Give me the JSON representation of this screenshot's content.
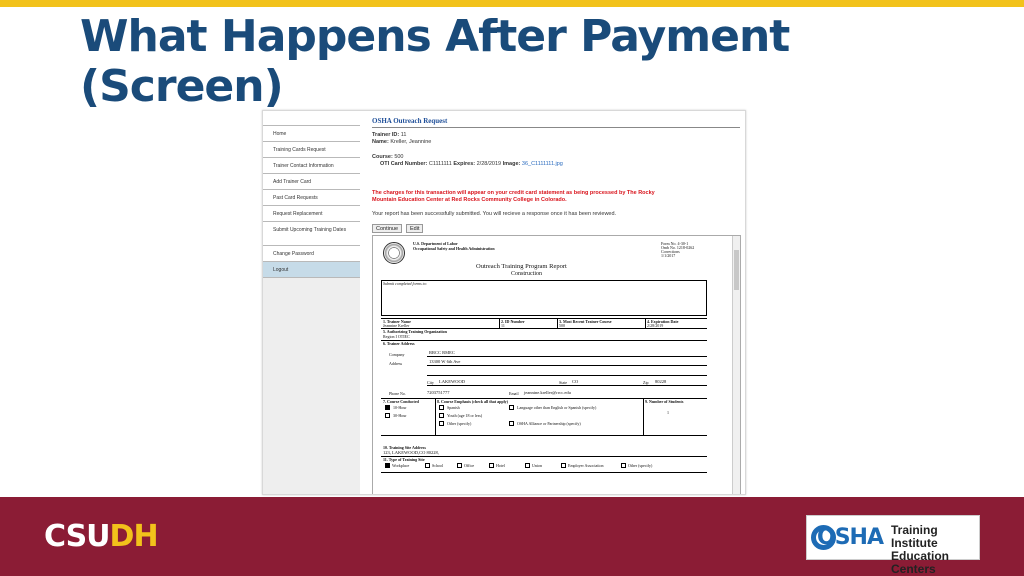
{
  "slide": {
    "title_line1": "What Happens After Payment",
    "title_line2": "(Screen)",
    "footer_logo": {
      "csu": "CSU",
      "dh": "DH"
    },
    "osha_logo": {
      "word": "OSHA",
      "line1": "Training Institute",
      "line2": "Education Centers"
    },
    "colors": {
      "title": "#1a4b7a",
      "footer": "#8b1c35",
      "accent": "#f2c21b"
    }
  },
  "sidebar": {
    "items": [
      {
        "label": "Home"
      },
      {
        "label": "Training Cards Request"
      },
      {
        "label": "Trainer Contact Information"
      },
      {
        "label": "Add Trainer Card"
      },
      {
        "label": "Past Card Requests"
      },
      {
        "label": "Request Replacement"
      },
      {
        "label": "Submit Upcoming Training Dates"
      },
      {
        "label": "Change Password"
      },
      {
        "label": "Logout"
      }
    ]
  },
  "request": {
    "heading": "OSHA Outreach Request",
    "trainer_id_label": "Trainer ID:",
    "trainer_id": "11",
    "name_label": "Name:",
    "name": "Kreller, Jeannine",
    "course_label": "Course:",
    "course": "500",
    "oti_label": "OTI Card Number:",
    "oti": "C1111111",
    "expires_label": "Expires:",
    "expires": "2/28/2019",
    "image_label": "Image:",
    "image": "36_C1111111.jpg",
    "charge_notice_1": "The charges for this transaction will appear on your credit card statement as being processed by The Rocky",
    "charge_notice_2": "Mountain Education Center at Red Rocks Community College in Colorado.",
    "success": "Your report has been successfully submitted. You will recieve a response once it has been reviewed.",
    "continue_label": "Continue",
    "edit_label": "Edit"
  },
  "form": {
    "dept_1": "U.S. Department of Labor",
    "dept_2": "Occupational Safety and Health Administration",
    "form_no_1": "Form No. 4-30-1",
    "form_no_2": "Omb No. 1218-0262",
    "form_no_3": "Corrections",
    "form_no_4": "1/1/2017",
    "title_1": "Outreach Training Program Report",
    "title_2": "Construction",
    "submit_label": "Submit completed forms to:",
    "f1_label": "1.   Trainer Name",
    "f1_value": "Jeannine   Kreller",
    "f2_label": "2.   ID Number",
    "f2_value": "11",
    "f3_label": "3.   Most Recent Trainer Course",
    "f3_value": "500",
    "f4_label": "4.   Expiration Date",
    "f4_value": "2/28/2019",
    "f5_label": "5.   Authorizing Training Organization",
    "f5_value": "Region I OTIEC",
    "f6_label": "6.   Trainer Address",
    "company_label": "Company",
    "company": "RRCC RMEC",
    "address_label": "Address",
    "address": "13300 W 6th Ave",
    "city_label": "City",
    "city": "LAKEWOOD",
    "state_label": "State",
    "state": "CO",
    "zip_label": "Zip",
    "zip": "80228",
    "phone_label": "Phone No.",
    "phone": "7203751777",
    "email_label": "Email",
    "email": "jeannine.kreller@rrcc.edu",
    "f7_label": "7.   Course Conducted",
    "f7_opt1": "10-Hour",
    "f7_opt2": "30-Hour",
    "f8_label": "8.   Course Emphasis (check all that apply)",
    "f8_opt1": "Spanish",
    "f8_opt2": "Language other than English or Spanish (specify)",
    "f8_opt3": "Youth (age 18 or less)",
    "f8_opt4": "Other (specify)",
    "f8_opt5": "OSHA Alliance or Partnership (specify)",
    "f9_label": "9.   Number of Students",
    "f9_value": "1",
    "f10_label": "10.   Training Site Address",
    "f10_value": "123, LAKEWOOD,CO 80228,",
    "f11_label": "11.   Type of Training Site",
    "f11_opt1": "Workplace",
    "f11_opt2": "School",
    "f11_opt3": "Office",
    "f11_opt4": "Hotel",
    "f11_opt5": "Union",
    "f11_opt6": "Employer Association",
    "f11_opt7": "Other (specify)"
  }
}
